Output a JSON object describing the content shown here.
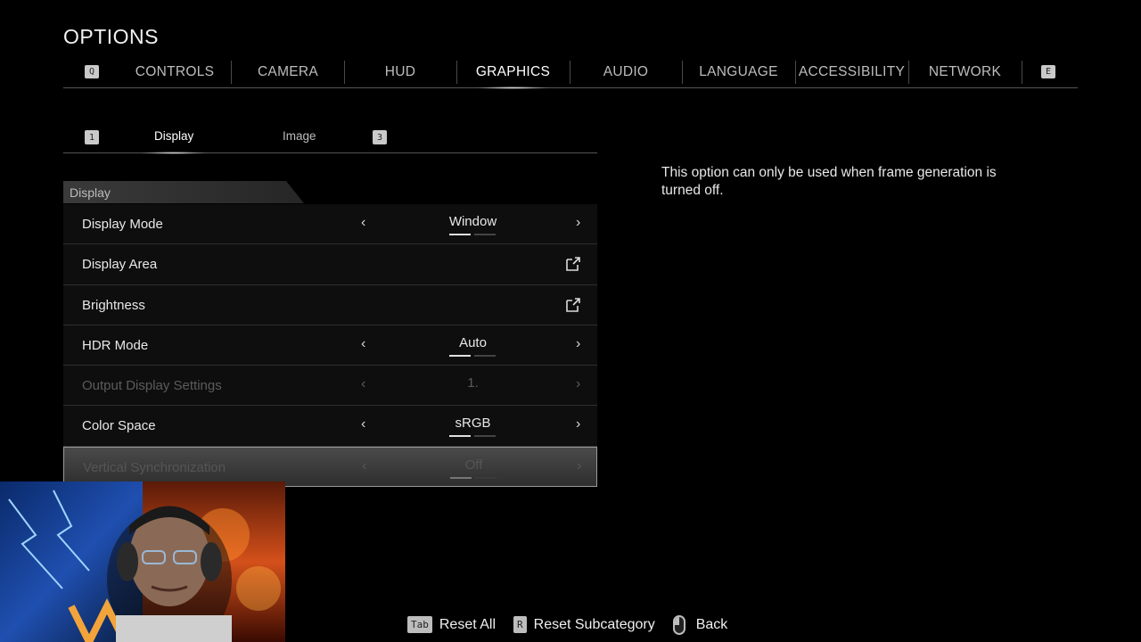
{
  "page_title": "OPTIONS",
  "top_tabs": {
    "left_key": "Q",
    "right_key": "E",
    "items": [
      "CONTROLS",
      "CAMERA",
      "HUD",
      "GRAPHICS",
      "AUDIO",
      "LANGUAGE",
      "ACCESSIBILITY",
      "NETWORK"
    ],
    "active": "GRAPHICS"
  },
  "sub_tabs": {
    "left_key": "1",
    "right_key": "3",
    "items": [
      "Display",
      "Image"
    ],
    "active": "Display"
  },
  "section": {
    "title": "Display"
  },
  "settings": [
    {
      "label": "Display Mode",
      "value": "Window",
      "type": "selector",
      "state": "enabled",
      "pips": [
        true,
        false
      ]
    },
    {
      "label": "Display Area",
      "type": "link",
      "state": "enabled"
    },
    {
      "label": "Brightness",
      "type": "link",
      "state": "enabled"
    },
    {
      "label": "HDR Mode",
      "value": "Auto",
      "type": "selector",
      "state": "enabled",
      "pips": [
        true,
        false
      ]
    },
    {
      "label": "Output Display Settings",
      "value": "1.",
      "type": "selector",
      "state": "disabled",
      "pips": []
    },
    {
      "label": "Color Space",
      "value": "sRGB",
      "type": "selector",
      "state": "enabled",
      "pips": [
        true,
        false
      ]
    },
    {
      "label": "Vertical Synchronization",
      "value": "Off",
      "type": "selector",
      "state": "selected-disabled",
      "pips": [
        true,
        false
      ]
    }
  ],
  "help_text": "This option can only be used when frame generation is turned off.",
  "footer": {
    "reset_all_key": "Tab",
    "reset_all_label": "Reset All",
    "reset_sub_key": "R",
    "reset_sub_label": "Reset Subcategory",
    "back_label": "Back"
  },
  "icons": {
    "arrow_left": "chevron-left-icon",
    "arrow_right": "chevron-right-icon",
    "external": "external-link-icon",
    "mouse": "mouse-icon"
  },
  "colors": {
    "background": "#000000",
    "text": "#e8e8e8",
    "disabled": "#5b5b5b",
    "selected_row": "#3a3a3a"
  }
}
